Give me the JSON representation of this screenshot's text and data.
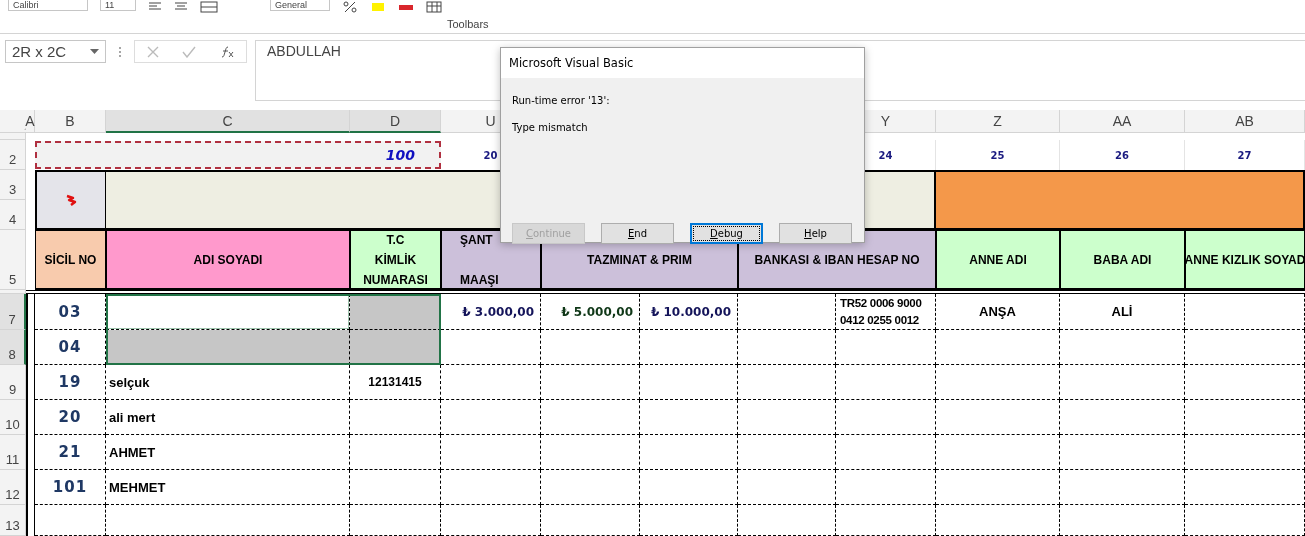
{
  "ribbon": {
    "font": "Calibri",
    "size": "11",
    "number_format": "General",
    "group_label": "Toolbars"
  },
  "formula_bar": {
    "name_box": "2R x 2C",
    "formula": "ABDULLAH"
  },
  "column_headers": [
    {
      "label": "A",
      "selected": false
    },
    {
      "label": "B",
      "selected": false
    },
    {
      "label": "C",
      "selected": true
    },
    {
      "label": "D",
      "selected": true
    },
    {
      "label": "U",
      "selected": false
    },
    {
      "label": "Y",
      "selected": false
    },
    {
      "label": "Z",
      "selected": false
    },
    {
      "label": "AA",
      "selected": false
    },
    {
      "label": "AB",
      "selected": false
    }
  ],
  "row_headers": [
    {
      "label": "2",
      "selected": false
    },
    {
      "label": "3",
      "selected": false
    },
    {
      "label": "4",
      "selected": false
    },
    {
      "label": "5",
      "selected": false
    },
    {
      "label": "7",
      "selected": true
    },
    {
      "label": "8",
      "selected": true
    },
    {
      "label": "9",
      "selected": false
    },
    {
      "label": "10",
      "selected": false
    },
    {
      "label": "11",
      "selected": false
    },
    {
      "label": "12",
      "selected": false
    },
    {
      "label": "13",
      "selected": false
    }
  ],
  "title_row": {
    "count": "100",
    "numbers": [
      "20",
      "24",
      "25",
      "26",
      "27"
    ]
  },
  "table_headers": [
    {
      "lines": [
        "SİCİL NO"
      ],
      "color": "#f8cbad"
    },
    {
      "lines": [
        "ADI SOYADI"
      ],
      "color": "#ff99cc"
    },
    {
      "lines": [
        "T.C",
        "KİMLİK",
        "NUMARASI"
      ],
      "color": "#ccffcc"
    },
    {
      "lines": [
        "ŞANT",
        "MAAŞI"
      ],
      "color": "#ccc0da"
    },
    {
      "lines": [
        "TAZMINAT & PRIM"
      ],
      "color": "#ccc0da"
    },
    {
      "lines": [
        "BANKASI & IBAN HESAP NO"
      ],
      "color": "#ccc0da"
    },
    {
      "lines": [
        "ANNE ADI"
      ],
      "color": "#ccffcc"
    },
    {
      "lines": [
        "BABA ADI"
      ],
      "color": "#ccffcc"
    },
    {
      "lines": [
        "ANNE KIZLIK SOYAD"
      ],
      "color": "#ccffcc"
    }
  ],
  "rows": [
    {
      "sicil": "03",
      "selected": true,
      "active": true,
      "salary": "₺ 3.000,00",
      "bonus": "₺ 5.000,00",
      "premium": "₺ 10.000,00",
      "iban": "TR52 0006 9000 0412 0255 0012",
      "mother": "ANŞA",
      "father": "ALİ"
    },
    {
      "sicil": "04",
      "selected": true,
      "active": false
    },
    {
      "sicil": "19",
      "selected": false,
      "active": false,
      "name": "selçuk",
      "tc": "12131415"
    },
    {
      "sicil": "20",
      "selected": false,
      "active": false,
      "name": "ali mert"
    },
    {
      "sicil": "21",
      "selected": false,
      "active": false,
      "name": "AHMET"
    },
    {
      "sicil": "101",
      "selected": false,
      "active": false,
      "name": "MEHMET"
    }
  ],
  "dialog": {
    "title": "Microsoft Visual Basic",
    "message": "Run-time error '13':",
    "detail": "Type mismatch",
    "buttons": [
      {
        "label": "Continue",
        "disabled": true,
        "default": false
      },
      {
        "label": "End",
        "disabled": false,
        "default": false
      },
      {
        "label": "Debug",
        "disabled": false,
        "default": true
      },
      {
        "label": "Help",
        "disabled": false,
        "default": false
      }
    ]
  }
}
